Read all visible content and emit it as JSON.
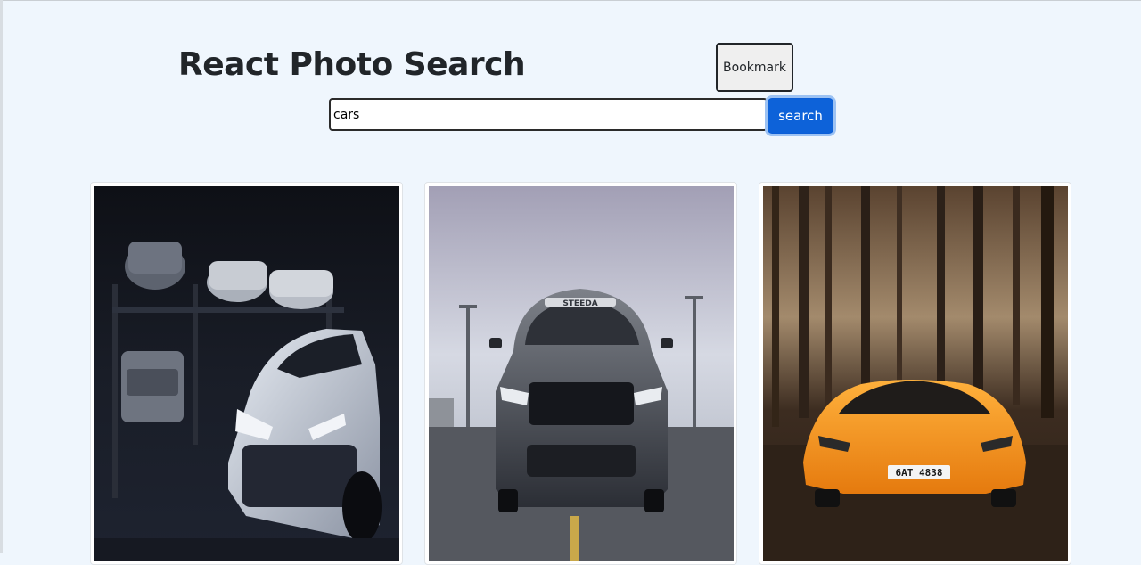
{
  "header": {
    "title": "React Photo Search",
    "bookmark_label": "Bookmark"
  },
  "search": {
    "value": "cars",
    "button_label": "search"
  },
  "results": {
    "photos": [
      {
        "subject": "white sports car in dark garage"
      },
      {
        "subject": "grey muscle car on road",
        "badge_text": "STEEDA"
      },
      {
        "subject": "orange supercar in forest",
        "plate_text": "6AT 4838"
      }
    ]
  },
  "colors": {
    "background": "#eff6fd",
    "accent": "#0d62d9"
  }
}
